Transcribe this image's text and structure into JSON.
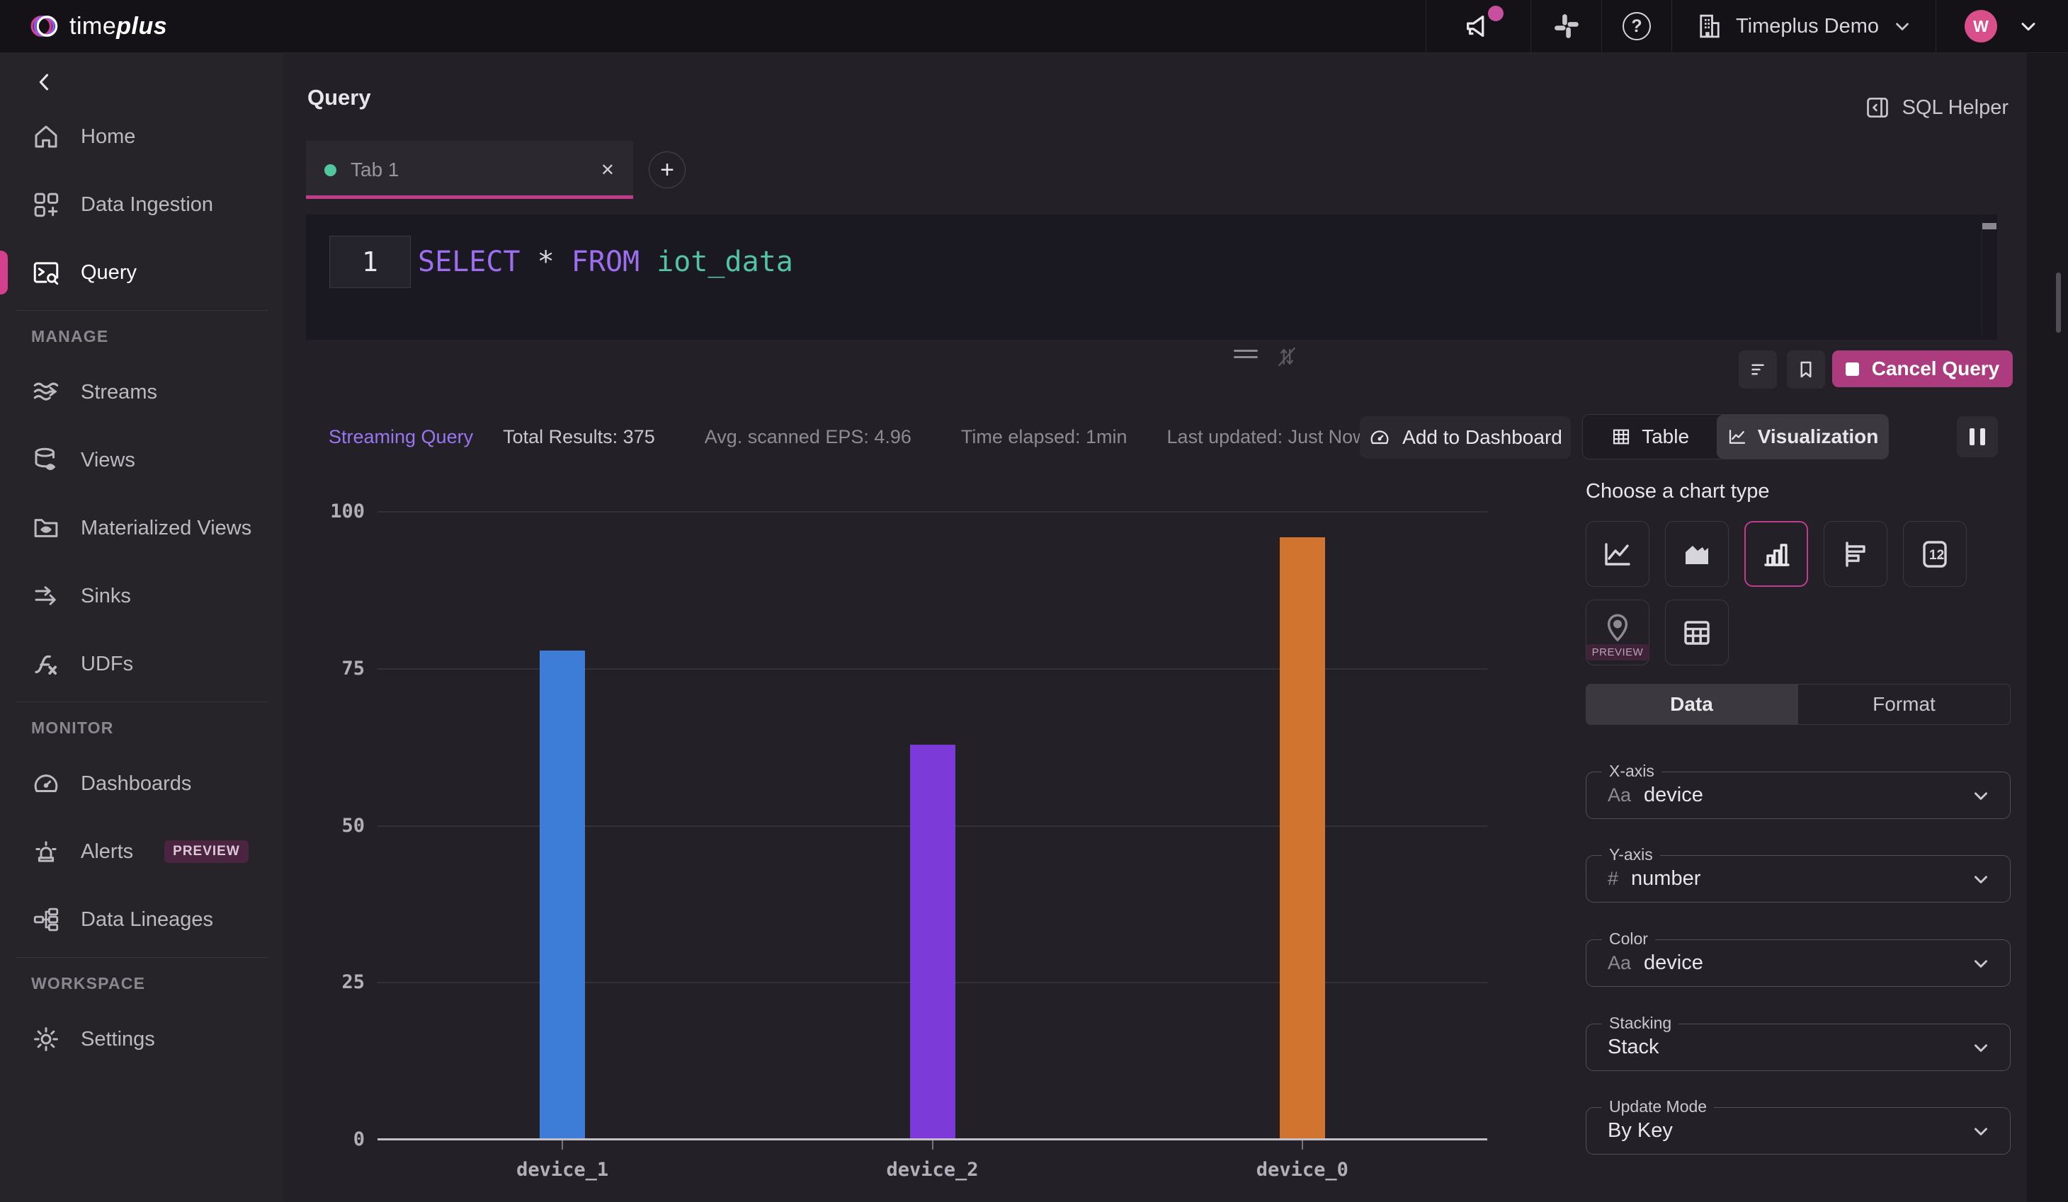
{
  "topbar": {
    "brand_time": "time",
    "brand_plus": "plus",
    "help_glyph": "?",
    "workspace_label": "Timeplus Demo",
    "avatar_initial": "W"
  },
  "sidebar": {
    "home": "Home",
    "data_ingestion": "Data Ingestion",
    "query": "Query",
    "manage_header": "MANAGE",
    "streams": "Streams",
    "views": "Views",
    "materialized_views": "Materialized Views",
    "sinks": "Sinks",
    "udfs": "UDFs",
    "monitor_header": "MONITOR",
    "dashboards": "Dashboards",
    "alerts": "Alerts",
    "alerts_badge": "PREVIEW",
    "data_lineages": "Data Lineages",
    "workspace_header": "WORKSPACE",
    "settings": "Settings"
  },
  "page": {
    "title": "Query",
    "sql_helper": "SQL Helper"
  },
  "tabs": {
    "tab1": "Tab 1",
    "close_glyph": "✕",
    "new_tab_glyph": "+"
  },
  "editor": {
    "line_number": "1",
    "sql": {
      "kw1": "SELECT",
      "star": "*",
      "kw2": "FROM",
      "ident": "iot_data"
    }
  },
  "run": {
    "cancel": "Cancel Query"
  },
  "status": {
    "streaming": "Streaming Query",
    "total": "Total Results: 375",
    "eps": "Avg. scanned EPS: 4.96",
    "elapsed": "Time elapsed: 1min",
    "updated": "Last updated: Just Now"
  },
  "actions": {
    "add_to_dashboard": "Add to Dashboard",
    "table": "Table",
    "visualization": "Visualization"
  },
  "panel": {
    "title": "Choose a chart type",
    "single_value_glyph": "12",
    "map_preview_badge": "PREVIEW",
    "tab_data": "Data",
    "tab_format": "Format",
    "xaxis_label": "X-axis",
    "xaxis_prefix": "Aa",
    "xaxis_value": "device",
    "yaxis_label": "Y-axis",
    "yaxis_prefix": "#",
    "yaxis_value": "number",
    "color_label": "Color",
    "color_prefix": "Aa",
    "color_value": "device",
    "stacking_label": "Stacking",
    "stacking_value": "Stack",
    "update_label": "Update Mode",
    "update_value": "By Key"
  },
  "colors": {
    "accent_pink": "#c13c8b",
    "cancel_button": "#ad3c7e",
    "streaming_purple": "#9a75f0",
    "tab_dot_green": "#52c79e"
  },
  "chart_data": {
    "type": "bar",
    "categories": [
      "device_1",
      "device_2",
      "device_0"
    ],
    "values": [
      78,
      63,
      96
    ],
    "colors": [
      "#3d7cd7",
      "#7c3ad8",
      "#d0742f"
    ],
    "title": "",
    "xlabel": "",
    "ylabel": "",
    "ylim": [
      0,
      100
    ],
    "yticks": [
      0,
      25,
      50,
      75,
      100
    ],
    "grid": true,
    "legend": false
  }
}
